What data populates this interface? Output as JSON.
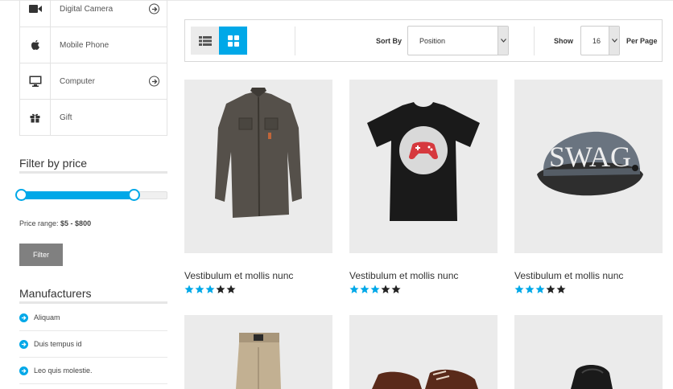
{
  "categories": [
    {
      "label": "Digital Camera",
      "icon": "video-camera-icon",
      "has_arrow": true
    },
    {
      "label": "Mobile Phone",
      "icon": "apple-icon",
      "has_arrow": false
    },
    {
      "label": "Computer",
      "icon": "monitor-icon",
      "has_arrow": true
    },
    {
      "label": "Gift",
      "icon": "gift-icon",
      "has_arrow": false
    }
  ],
  "price_filter": {
    "title": "Filter by price",
    "range_label": "Price range:",
    "range_value": "$5 - $800",
    "button": "Filter",
    "slider_low_fraction": 0.0,
    "slider_high_fraction": 0.79
  },
  "manufacturers": {
    "title": "Manufacturers",
    "items": [
      "Aliquam",
      "Duis tempus id",
      "Leo quis molestie."
    ]
  },
  "toolbar": {
    "sort_label": "Sort By",
    "sort_value": "Position",
    "show_label": "Show",
    "show_value": "16",
    "per_page_label": "Per Page"
  },
  "products": [
    {
      "name": "Vestibulum et mollis nunc",
      "rating": 3,
      "max_rating": 5,
      "image": "shirt"
    },
    {
      "name": "Vestibulum et mollis nunc",
      "rating": 3,
      "max_rating": 5,
      "image": "tshirt"
    },
    {
      "name": "Vestibulum et mollis nunc",
      "rating": 3,
      "max_rating": 5,
      "image": "cap",
      "image_text": "SWAG"
    },
    {
      "name": "",
      "rating": 0,
      "max_rating": 0,
      "image": "pants"
    },
    {
      "name": "",
      "rating": 0,
      "max_rating": 0,
      "image": "shoes"
    },
    {
      "name": "",
      "rating": 0,
      "max_rating": 0,
      "image": "boot"
    }
  ],
  "colors": {
    "accent": "#00a8e8",
    "star_empty": "#222222"
  }
}
